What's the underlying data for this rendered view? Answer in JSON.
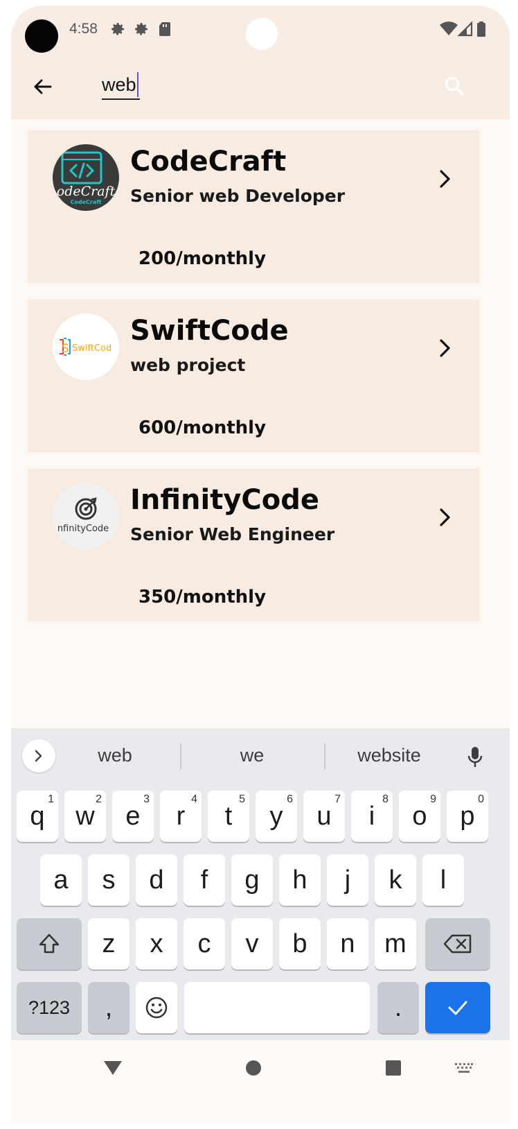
{
  "status_bar": {
    "time": "4:58",
    "icons": [
      "settings-icon",
      "settings-icon",
      "sd-card-icon",
      "wifi-icon",
      "signal-icon",
      "battery-icon"
    ]
  },
  "search": {
    "query": "web"
  },
  "jobs": [
    {
      "company": "CodeCraft",
      "logo_text": "odeCraft",
      "logo_subtext": "CodeCraft",
      "role": "Senior web Developer",
      "price": "200/monthly"
    },
    {
      "company": "SwiftCode",
      "logo_text": "SwiftCod",
      "logo_letter": "S",
      "role": "web project",
      "price": "600/monthly"
    },
    {
      "company": "InfinityCode",
      "logo_text": "nfinityCode",
      "role": "Senior Web Engineer",
      "price": "350/monthly"
    }
  ],
  "keyboard": {
    "suggestions": [
      "web",
      "we",
      "website"
    ],
    "row1": [
      "q",
      "w",
      "e",
      "r",
      "t",
      "y",
      "u",
      "i",
      "o",
      "p"
    ],
    "row1_hints": [
      "1",
      "2",
      "3",
      "4",
      "5",
      "6",
      "7",
      "8",
      "9",
      "0"
    ],
    "row2": [
      "a",
      "s",
      "d",
      "f",
      "g",
      "h",
      "j",
      "k",
      "l"
    ],
    "row3": [
      "z",
      "x",
      "c",
      "v",
      "b",
      "n",
      "m"
    ],
    "symbols_label": "?123",
    "comma": ",",
    "period": "."
  },
  "colors": {
    "header_bg": "#f8ede4",
    "card_bg": "#f8ece2",
    "keyboard_bg": "#e9eaee",
    "enter_key": "#1a73e8",
    "caret": "#6a4fc7"
  }
}
